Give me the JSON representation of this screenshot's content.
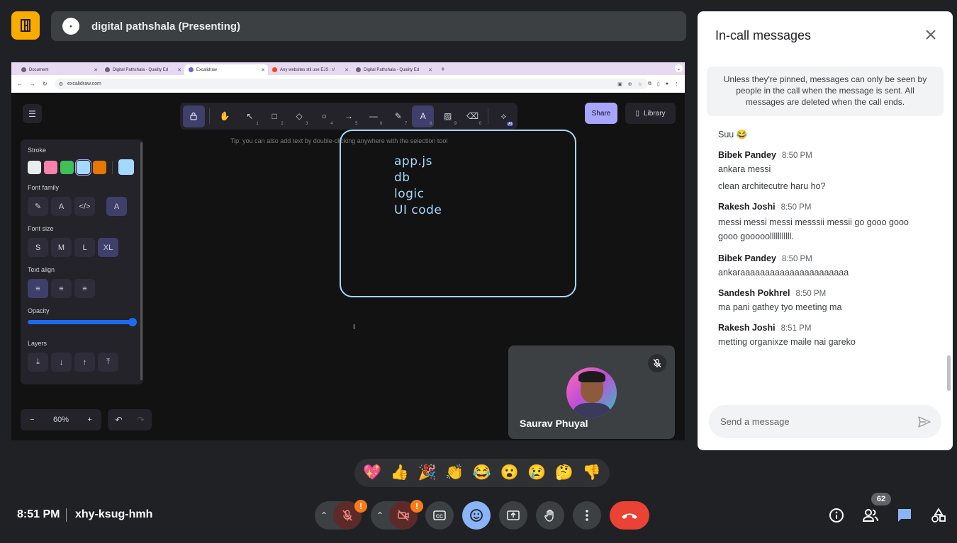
{
  "presenter": {
    "title": "digital pathshala (Presenting)"
  },
  "browser": {
    "tabs": [
      {
        "label": "Document"
      },
      {
        "label": "Digital Pathshala - Quality Ed"
      },
      {
        "label": "Excalidraw"
      },
      {
        "label": "Any websites stil use EJS : r/"
      },
      {
        "label": "Digital Pathshala - Quality Ed"
      }
    ],
    "url": "excalidraw.com"
  },
  "excalidraw": {
    "share_label": "Share",
    "library_label": "Library",
    "tip": "Tip: you can also add text by double-clicking anywhere with the selection tool",
    "tool_numbers": [
      "1",
      "2",
      "3",
      "4",
      "5",
      "6",
      "7",
      "8",
      "9",
      "0"
    ],
    "ai_badge": "AI",
    "panel": {
      "stroke_title": "Stroke",
      "font_family_title": "Font family",
      "font_size_title": "Font size",
      "sizes": [
        "S",
        "M",
        "L",
        "XL"
      ],
      "text_align_title": "Text align",
      "opacity_title": "Opacity",
      "opacity_value": 1.0,
      "layers_title": "Layers",
      "stroke_colors": [
        "#e9ecef",
        "#f783ac",
        "#40c057",
        "#a5d8ff",
        "#e67700",
        "#a5d8ff"
      ],
      "selected_stroke": "#a5d8ff"
    },
    "drawing_lines": [
      "app.js",
      "db",
      "logic",
      "UI code"
    ],
    "zoom": "60%"
  },
  "participant": {
    "name": "Saurav Phuyal"
  },
  "chat": {
    "title": "In-call messages",
    "note": "Unless they're pinned, messages can only be seen by people in the call when the message is sent. All messages are deleted when the call ends.",
    "first_line": "Suu 😂",
    "groups": [
      {
        "author": "Bibek Pandey",
        "time": "8:50 PM",
        "lines": [
          "ankara messi",
          "clean architecutre haru ho?"
        ]
      },
      {
        "author": "Rakesh Joshi",
        "time": "8:50 PM",
        "lines": [
          "messi messi messi messsii messii go gooo gooo gooo gooooolllllllllll."
        ]
      },
      {
        "author": "Bibek Pandey",
        "time": "8:50 PM",
        "lines": [
          "ankaraaaaaaaaaaaaaaaaaaaaaa"
        ]
      },
      {
        "author": "Sandesh Pokhrel",
        "time": "8:50 PM",
        "lines": [
          "ma pani gathey tyo meeting ma"
        ]
      },
      {
        "author": "Rakesh Joshi",
        "time": "8:51 PM",
        "lines": [
          "metting organixze maile nai gareko"
        ]
      }
    ],
    "input_placeholder": "Send a message"
  },
  "reactions": [
    "💖",
    "👍",
    "🎉",
    "👏",
    "😂",
    "😮",
    "😢",
    "🤔",
    "👎"
  ],
  "bottom": {
    "time": "8:51 PM",
    "meeting_code": "xhy-ksug-hmh",
    "warn_badge": "!",
    "people_count": "62"
  },
  "colors": {
    "meet_yellow": "#f9ab00",
    "end_call": "#ea4335",
    "active_blue": "#8ab4f8",
    "excalidraw_purple": "#a8a5ff"
  }
}
